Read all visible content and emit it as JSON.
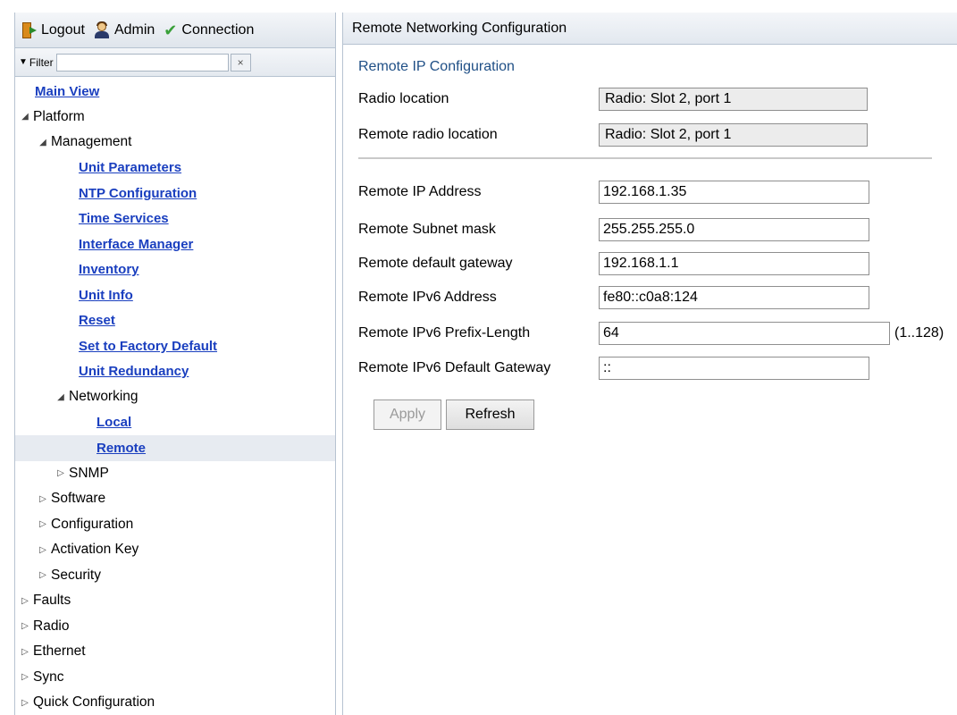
{
  "topbar": {
    "logout": "Logout",
    "admin": "Admin",
    "connection": "Connection"
  },
  "filter": {
    "label": "Filter",
    "value": "",
    "clear": "×"
  },
  "tree": {
    "main_view": "Main View",
    "platform": "Platform",
    "management": "Management",
    "management_items": [
      "Unit Parameters",
      "NTP Configuration",
      "Time Services",
      "Interface Manager",
      "Inventory",
      "Unit Info",
      "Reset",
      "Set to Factory Default",
      "Unit Redundancy"
    ],
    "networking": "Networking",
    "networking_items": [
      "Local",
      "Remote"
    ],
    "snmp": "SNMP",
    "platform_items": [
      "Software",
      "Configuration",
      "Activation Key",
      "Security"
    ],
    "root_items": [
      "Faults",
      "Radio",
      "Ethernet",
      "Sync",
      "Quick Configuration"
    ],
    "selected": "Remote"
  },
  "main": {
    "header": "Remote Networking Configuration",
    "section_title": "Remote IP Configuration",
    "radio_location_label": "Radio location",
    "radio_location_value": "Radio: Slot 2, port 1",
    "remote_radio_location_label": "Remote radio location",
    "remote_radio_location_value": "Radio: Slot 2, port 1",
    "ip_label": "Remote IP Address",
    "ip_value": "192.168.1.35",
    "mask_label": "Remote Subnet mask",
    "mask_value": "255.255.255.0",
    "gateway_label": "Remote default gateway",
    "gateway_value": "192.168.1.1",
    "ipv6_label": "Remote IPv6 Address",
    "ipv6_value": "fe80::c0a8:124",
    "prefix_label": "Remote IPv6 Prefix-Length",
    "prefix_value": "64",
    "prefix_range": "(1..128)",
    "ipv6_gw_label": "Remote IPv6 Default Gateway",
    "ipv6_gw_value": "::",
    "apply": "Apply",
    "refresh": "Refresh"
  }
}
